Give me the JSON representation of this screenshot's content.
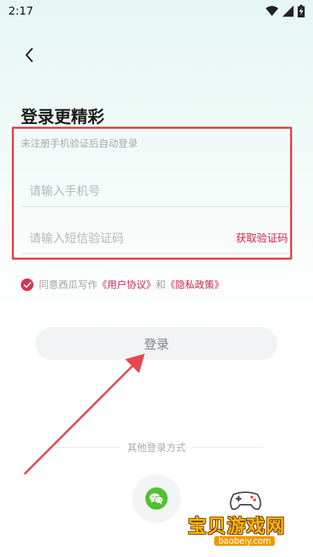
{
  "status": {
    "time": "2:17"
  },
  "login": {
    "title": "登录更精彩",
    "subtitle": "未注册手机验证后自动登录",
    "phone_placeholder": "请输入手机号",
    "code_placeholder": "请输入短信验证码",
    "get_code": "获取验证码",
    "agree_prefix": "同意西瓜写作",
    "user_agreement": "《用户协议》",
    "and": "和",
    "privacy_policy": "《隐私政策》",
    "login_button": "登录",
    "other_methods": "其他登录方式"
  },
  "watermark": {
    "name": "宝贝游戏网",
    "domain": "baobeiy.com"
  },
  "colors": {
    "accent": "#d6274f",
    "highlight": "#e4484d",
    "wechat": "#4fc230"
  }
}
